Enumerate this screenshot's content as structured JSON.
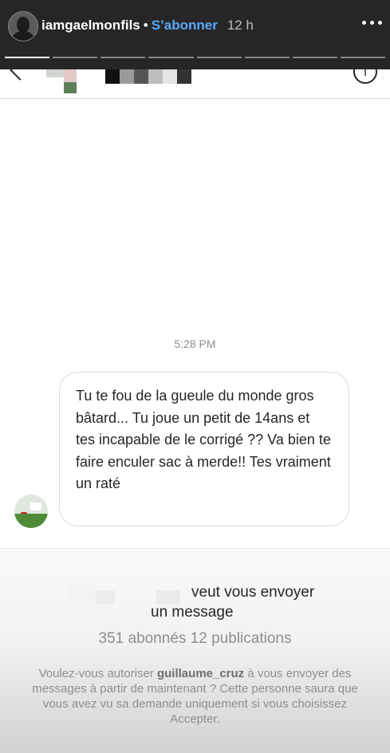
{
  "story": {
    "username": "iamgaelmonfils",
    "separator": "•",
    "follow_label": "S’abonner",
    "time_ago": "12 h",
    "more_icon": "ellipsis-icon",
    "progress_segments": 8,
    "progress_done": 1
  },
  "dm": {
    "timestamp": "5:28 PM",
    "message": "Tu te fou de la gueule du monde gros bâtard... Tu joue un petit de 14ans et tes incapable de le corrigé ?? Va bien te faire enculer sac à merde!! Tes vraiment un raté",
    "info_glyph": "i"
  },
  "request": {
    "line1": "veut vous envoyer",
    "line2": "un message",
    "counts": "351 abonnés 12 publications",
    "prompt_before": "Voulez-vous autoriser ",
    "prompt_user": "guillaume_cruz",
    "prompt_after": " à vous envoyer des messages à partir de maintenant ? Cette personne saura que vous avez vu sa demande uniquement si vous choisissez Accepter."
  },
  "colors": {
    "story_header_bg": "#262626",
    "follow_blue": "#5aa9ff",
    "secondary_text": "#8e8e8e",
    "border": "#dbdbdb"
  }
}
